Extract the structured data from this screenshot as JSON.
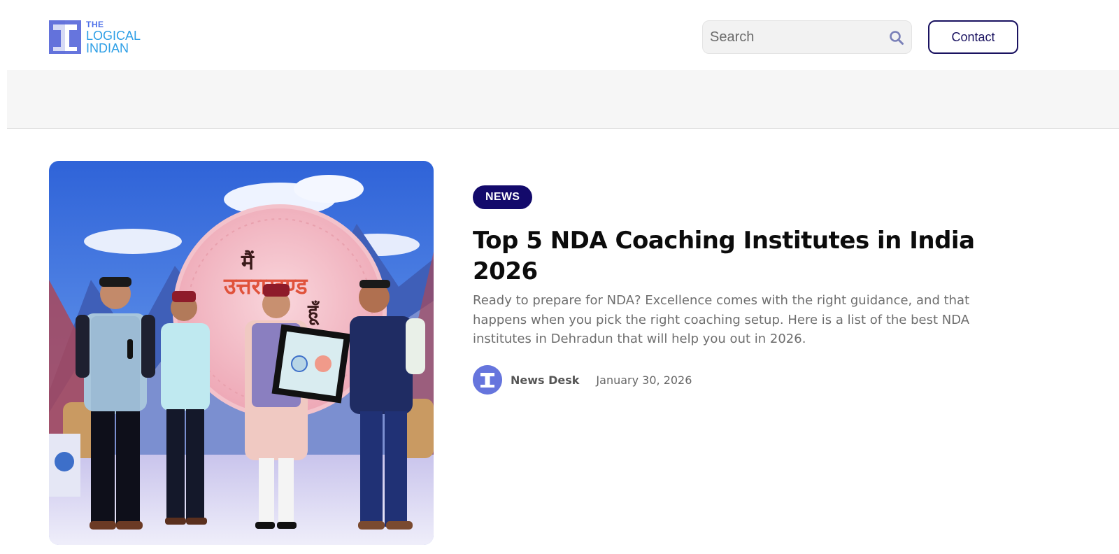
{
  "header": {
    "logo": {
      "line1": "THE",
      "line2": "LOGICAL",
      "line3": "INDIAN"
    },
    "search": {
      "placeholder": "Search"
    },
    "contact_label": "Contact"
  },
  "article": {
    "category": "NEWS",
    "title": "Top 5 NDA Coaching Institutes in India 2026",
    "excerpt": "Ready to prepare for NDA? Excellence comes with the right guidance, and that happens when you pick the right coaching setup. Here is a list of the best NDA institutes in Dehradun that will help you out in 2026.",
    "author": "News Desk",
    "date": "January 30, 2026",
    "image_banner_text": {
      "line1": "मैं",
      "line2": "उत्तराखण्ड",
      "line3": "हूँ"
    }
  },
  "colors": {
    "brand_navy": "#130a6b",
    "logo_purple": "#6675dd",
    "logo_blue": "#2e9fe6"
  },
  "icons": {
    "search": "search-icon"
  }
}
